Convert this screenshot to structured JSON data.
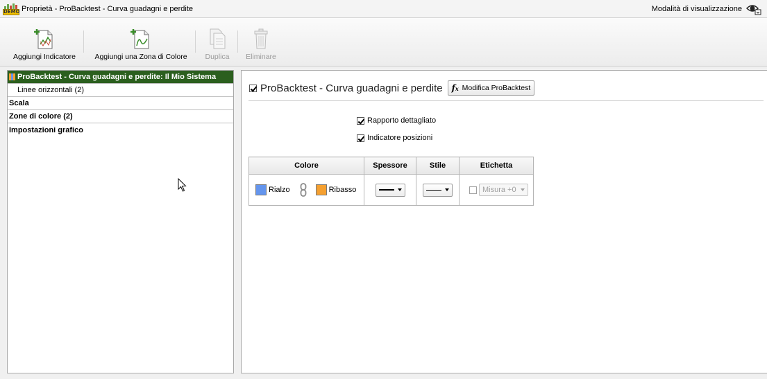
{
  "window": {
    "title": "Proprietà - ProBacktest - Curva guadagni e perdite",
    "app_badge": "DEMO",
    "view_mode_label": "Modalità di visualizzazione"
  },
  "toolbar": {
    "add_indicator": "Aggiungi Indicatore",
    "add_color_zone": "Aggiungi una Zona di Colore",
    "duplicate": "Duplica",
    "delete": "Eliminare"
  },
  "tree": {
    "items": [
      {
        "label": "ProBacktest - Curva guadagni e perdite: Il Mio Sistema",
        "selected": true
      },
      {
        "label": "Linee orizzontali (2)"
      },
      {
        "label": "Scala"
      },
      {
        "label": "Zone di colore (2)"
      },
      {
        "label": "Impostazioni grafico"
      }
    ]
  },
  "panel": {
    "title": "ProBacktest - Curva guadagni e perdite",
    "title_checked": true,
    "edit_button": "Modifica ProBacktest",
    "options": [
      {
        "label": "Rapporto dettagliato",
        "checked": true
      },
      {
        "label": "Indicatore posizioni",
        "checked": true
      }
    ],
    "table": {
      "headers": [
        "Colore",
        "Spessore",
        "Stile",
        "Etichetta"
      ],
      "rise_label": "Rialzo",
      "fall_label": "Ribasso",
      "rise_color": "#6495ed",
      "fall_color": "#f5a030",
      "label_checked": false,
      "label_select": "Misura +0"
    }
  },
  "colors": {
    "selected_row": "#2b5f1e"
  }
}
